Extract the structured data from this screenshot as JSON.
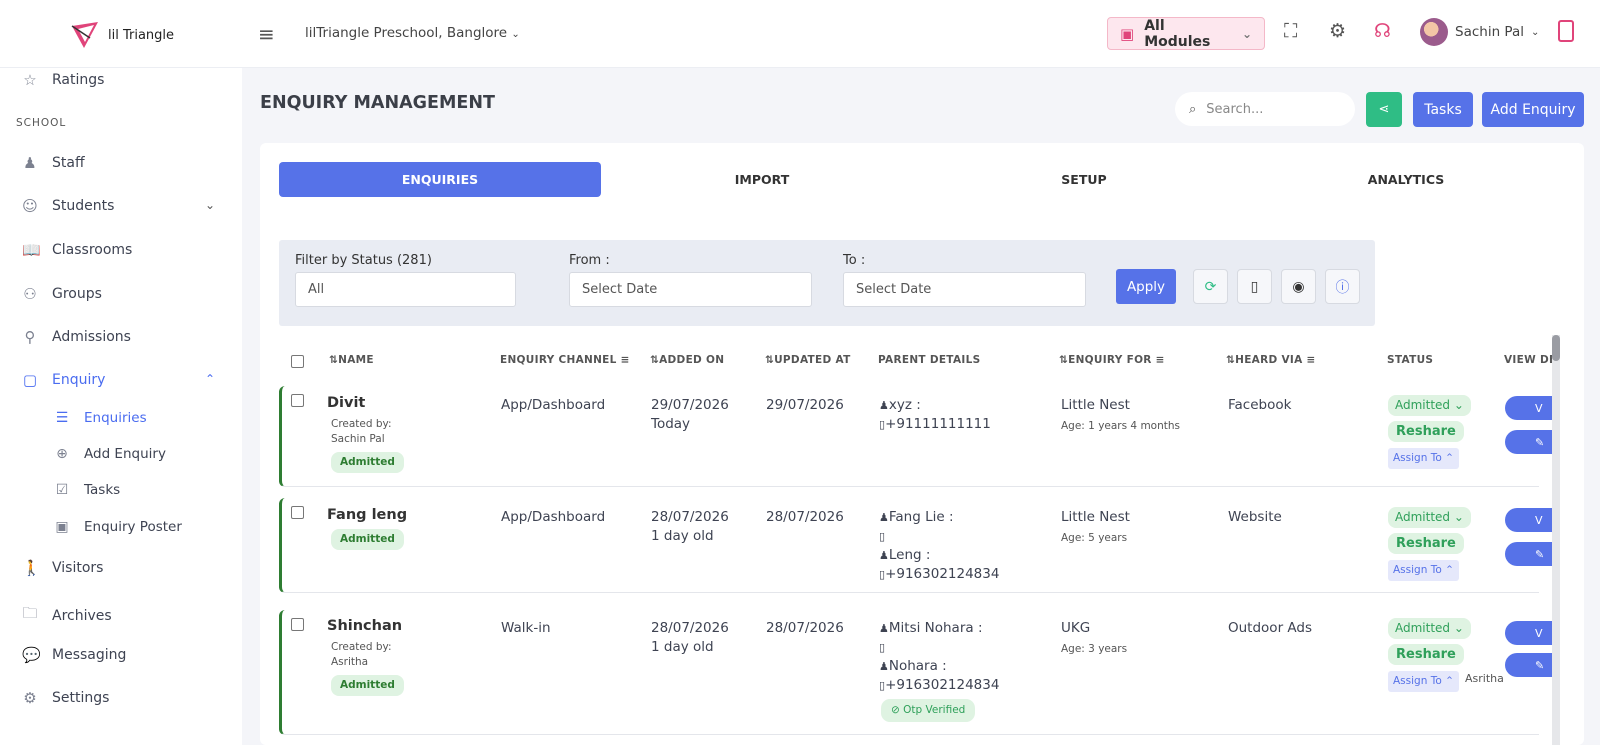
{
  "header": {
    "logo_text": "lil Triangle",
    "school": "lilTriangle Preschool, Banglore",
    "modules_label": "All Modules",
    "user_name": "Sachin Pal"
  },
  "sidebar": {
    "top_item": "Ratings",
    "section": "SCHOOL",
    "items": [
      {
        "label": "Staff"
      },
      {
        "label": "Students"
      },
      {
        "label": "Classrooms"
      },
      {
        "label": "Groups"
      },
      {
        "label": "Admissions"
      },
      {
        "label": "Enquiry"
      }
    ],
    "subitems": [
      {
        "label": "Enquiries"
      },
      {
        "label": "Add Enquiry"
      },
      {
        "label": "Tasks"
      },
      {
        "label": "Enquiry Poster"
      }
    ],
    "bottom_items": [
      {
        "label": "Visitors"
      },
      {
        "label": "Archives"
      },
      {
        "label": "Messaging"
      },
      {
        "label": "Settings"
      }
    ]
  },
  "main": {
    "title": "ENQUIRY MANAGEMENT",
    "search_placeholder": "Search...",
    "tasks_label": "Tasks",
    "add_enquiry_label": "Add Enquiry",
    "tabs": [
      "ENQUIRIES",
      "IMPORT",
      "SETUP",
      "ANALYTICS"
    ],
    "filters": {
      "status_label": "Filter by Status (281)",
      "status_value": "All",
      "from_label": "From :",
      "from_placeholder": "Select Date",
      "to_label": "To :",
      "to_placeholder": "Select Date",
      "apply_label": "Apply"
    },
    "columns": [
      "NAME",
      "ENQUIRY CHANNEL",
      "ADDED ON",
      "UPDATED AT",
      "PARENT DETAILS",
      "ENQUIRY FOR",
      "HEARD VIA",
      "STATUS",
      "VIEW DE"
    ]
  },
  "rows": [
    {
      "name": "Divit",
      "created_by_label": "Created by:",
      "created_by": "Sachin Pal",
      "badge": "Admitted",
      "channel": "App/Dashboard",
      "added_on": "29/07/2026",
      "added_ago": "Today",
      "updated_at": "29/07/2026",
      "parent1": "xyz :",
      "phone1": "+91111111111",
      "enquiry_for": "Little Nest",
      "age": "Age: 1 years 4 months",
      "heard_via": "Facebook",
      "status": "Admitted",
      "reshare": "Reshare",
      "assign": "Assign To"
    },
    {
      "name": "Fang leng",
      "badge": "Admitted",
      "channel": "App/Dashboard",
      "added_on": "28/07/2026",
      "added_ago": "1 day old",
      "updated_at": "28/07/2026",
      "parent1": "Fang Lie :",
      "phone1": "",
      "parent2": "Leng :",
      "phone2": "+916302124834",
      "enquiry_for": "Little Nest",
      "age": "Age: 5 years",
      "heard_via": "Website",
      "status": "Admitted",
      "reshare": "Reshare",
      "assign": "Assign To"
    },
    {
      "name": "Shinchan",
      "created_by_label": "Created by:",
      "created_by": "Asritha",
      "badge": "Admitted",
      "channel": "Walk-in",
      "added_on": "28/07/2026",
      "added_ago": "1 day old",
      "updated_at": "28/07/2026",
      "parent1": "Mitsi Nohara :",
      "phone1": "",
      "parent2": "Nohara :",
      "phone2": "+916302124834",
      "otp": "Otp Verified",
      "enquiry_for": "UKG",
      "age": "Age: 3 years",
      "heard_via": "Outdoor Ads",
      "status": "Admitted",
      "reshare": "Reshare",
      "assign": "Assign To",
      "assignee": "Asritha"
    }
  ],
  "colors": {
    "primary": "#5672e8",
    "green": "#2fbd85",
    "admitted_border": "#2e7d32",
    "brand_pink": "#e0447a"
  }
}
